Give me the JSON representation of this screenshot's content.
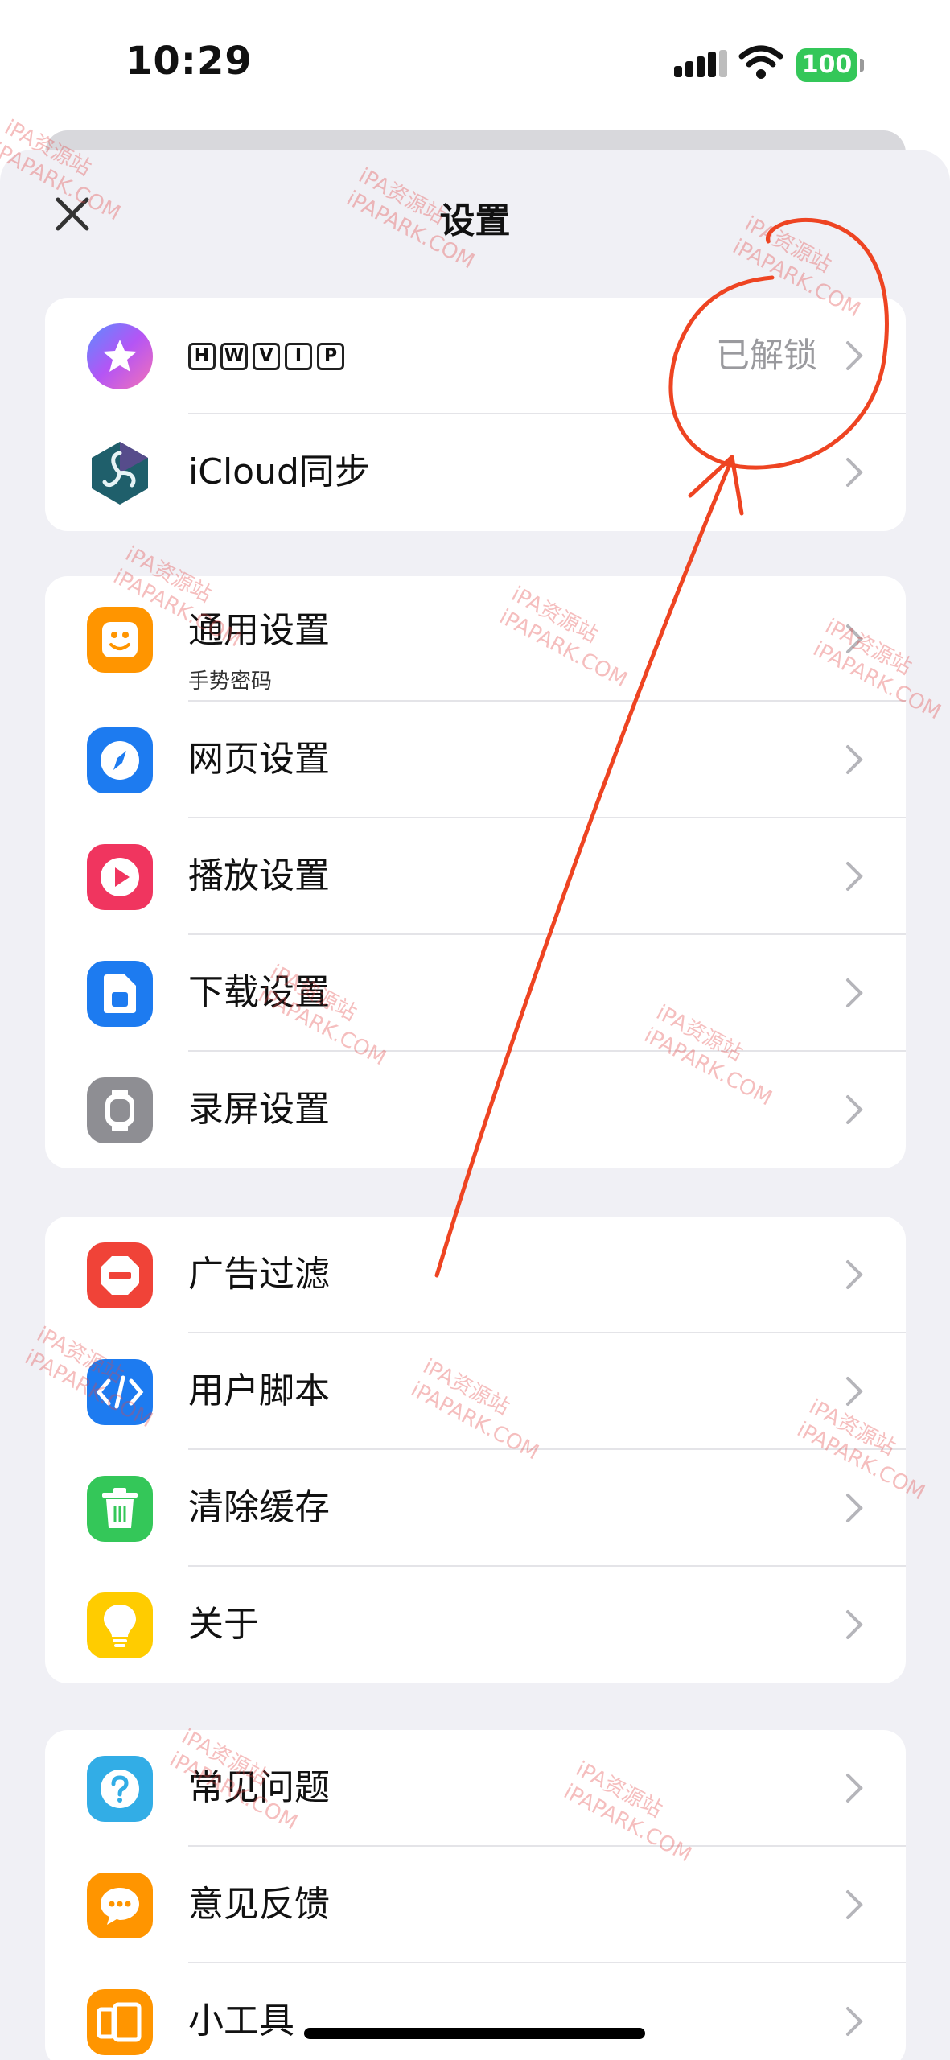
{
  "status_bar": {
    "time": "10:29",
    "battery": "100"
  },
  "header": {
    "title": "设置"
  },
  "groups": [
    {
      "items": [
        {
          "label": "",
          "badges": [
            "H",
            "W",
            "V",
            "I",
            "P"
          ],
          "value": "已解锁",
          "icon": "star-icon",
          "icon_color": "#8b5cf6"
        },
        {
          "label": "iCloud同步",
          "icon": "triskelion-icon",
          "icon_color": "#1f5f6b"
        }
      ]
    },
    {
      "items": [
        {
          "label": "通用设置",
          "sublabel": "手势密码",
          "icon": "general-settings-icon",
          "icon_color": "#ff9500"
        },
        {
          "label": "网页设置",
          "icon": "compass-icon",
          "icon_color": "#1d7bf0"
        },
        {
          "label": "播放设置",
          "icon": "play-icon",
          "icon_color": "#f0355f"
        },
        {
          "label": "下载设置",
          "icon": "download-icon",
          "icon_color": "#1d7bf0"
        },
        {
          "label": "录屏设置",
          "icon": "watch-icon",
          "icon_color": "#8e8e93"
        }
      ]
    },
    {
      "items": [
        {
          "label": "广告过滤",
          "icon": "stop-icon",
          "icon_color": "#f04338"
        },
        {
          "label": "用户脚本",
          "icon": "code-icon",
          "icon_color": "#1d7bf0"
        },
        {
          "label": "清除缓存",
          "icon": "trash-icon",
          "icon_color": "#34c759"
        },
        {
          "label": "关于",
          "icon": "lightbulb-icon",
          "icon_color": "#ffcc00"
        }
      ]
    },
    {
      "items": [
        {
          "label": "常见问题",
          "icon": "question-icon",
          "icon_color": "#32ade6"
        },
        {
          "label": "意见反馈",
          "icon": "chat-bubble-icon",
          "icon_color": "#ff9500"
        },
        {
          "label": "小工具",
          "icon": "tools-icon",
          "icon_color": "#ff9500"
        }
      ]
    }
  ],
  "watermark": {
    "line1": "iPA资源站",
    "line2": "iPAPARK.COM"
  },
  "colors": {
    "annotation": "#ee4422",
    "accent_green": "#34c759"
  }
}
